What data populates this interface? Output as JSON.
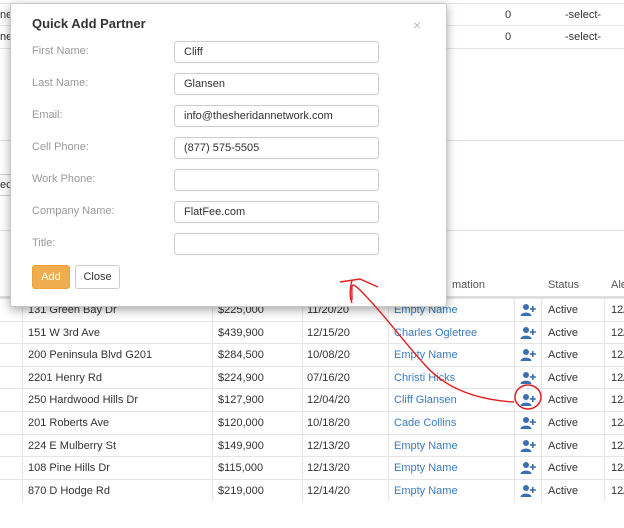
{
  "top_rows": [
    {
      "left_text": "ne",
      "count": "0",
      "select": "-select-"
    },
    {
      "left_text": "ne",
      "count": "0",
      "select": "-select-"
    }
  ],
  "select_fragment": "ec",
  "table": {
    "headers": {
      "info": "mation",
      "status": "Status",
      "alert": "Ale"
    },
    "rows": [
      {
        "address": "131 Green Bay Dr",
        "price": "$225,000",
        "date": "11/20/20",
        "partner": "Empty Name",
        "status": "Active",
        "extra": "12/"
      },
      {
        "address": "151 W 3rd Ave",
        "price": "$439,900",
        "date": "12/15/20",
        "partner": "Charles Ogletree",
        "status": "Active",
        "extra": "12/"
      },
      {
        "address": "200 Peninsula Blvd G201",
        "price": "$284,500",
        "date": "10/08/20",
        "partner": "Empty Name",
        "status": "Active",
        "extra": "12/"
      },
      {
        "address": "2201 Henry Rd",
        "price": "$224,900",
        "date": "07/16/20",
        "partner": "Christi Hicks",
        "status": "Active",
        "extra": "12/"
      },
      {
        "address": "250 Hardwood Hills Dr",
        "price": "$127,900",
        "date": "12/04/20",
        "partner": "Cliff Glansen",
        "status": "Active",
        "extra": "12/"
      },
      {
        "address": "201 Roberts Ave",
        "price": "$120,000",
        "date": "10/18/20",
        "partner": "Cade Collins",
        "status": "Active",
        "extra": "12/"
      },
      {
        "address": "224 E Mulberry St",
        "price": "$149,900",
        "date": "12/13/20",
        "partner": "Empty Name",
        "status": "Active",
        "extra": "12/"
      },
      {
        "address": "108 Pine Hills Dr",
        "price": "$115,000",
        "date": "12/13/20",
        "partner": "Empty Name",
        "status": "Active",
        "extra": "12/"
      },
      {
        "address": "870 D Hodge Rd",
        "price": "$219,000",
        "date": "12/14/20",
        "partner": "Empty Name",
        "status": "Active",
        "extra": "12/"
      }
    ]
  },
  "modal": {
    "title": "Quick Add Partner",
    "close_glyph": "×",
    "fields": {
      "first_name": {
        "label": "First Name:",
        "value": "Cliff"
      },
      "last_name": {
        "label": "Last Name:",
        "value": "Glansen"
      },
      "email": {
        "label": "Email:",
        "value": "info@thesheridannetwork.com"
      },
      "cell_phone": {
        "label": "Cell Phone:",
        "value": "(877) 575-5505"
      },
      "work_phone": {
        "label": "Work Phone:",
        "value": ""
      },
      "company_name": {
        "label": "Company Name:",
        "value": "FlatFee.com"
      },
      "title": {
        "label": "Title:",
        "value": ""
      }
    },
    "add_label": "Add",
    "close_label": "Close"
  },
  "colors": {
    "accent": "#f0ad4e",
    "link": "#3a7bbf",
    "annotation": "#e02020",
    "icon": "#3a6fb0"
  }
}
